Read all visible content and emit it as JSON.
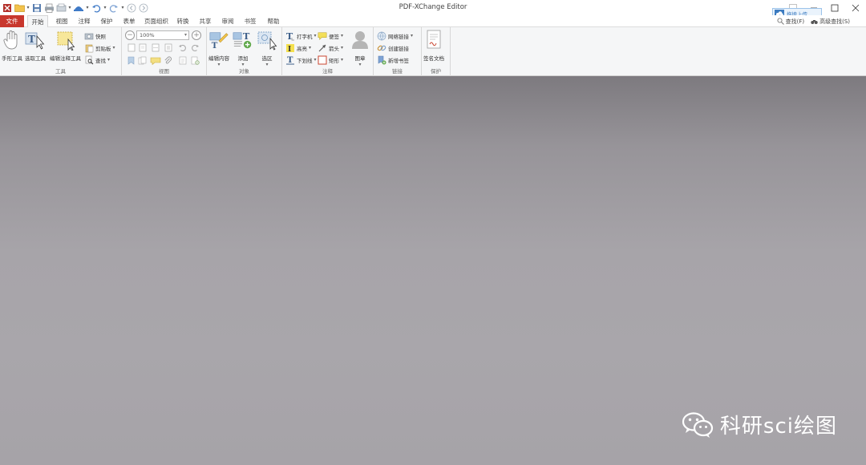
{
  "window": {
    "title": "PDF-XChange Editor",
    "minimize_icon": "minimize-icon",
    "maximize_icon": "maximize-icon",
    "close_icon": "close-icon"
  },
  "quick_access": {
    "icons": [
      "app-logo-icon",
      "open-folder-icon",
      "save-icon",
      "print-icon",
      "scan-icon",
      "stamp-icon",
      "undo-icon",
      "redo-icon",
      "back-icon",
      "forward-icon"
    ]
  },
  "tabs": [
    {
      "label": "文件",
      "active": false,
      "file": true
    },
    {
      "label": "开始",
      "active": true
    },
    {
      "label": "视图"
    },
    {
      "label": "注释"
    },
    {
      "label": "保护"
    },
    {
      "label": "表单"
    },
    {
      "label": "页面组织"
    },
    {
      "label": "转换"
    },
    {
      "label": "共享"
    },
    {
      "label": "审阅"
    },
    {
      "label": "书签"
    },
    {
      "label": "帮助"
    }
  ],
  "right_tools": {
    "cloud_upload": "拖拽上传",
    "find": "查找(F)",
    "advanced_search": "高级查找(S)"
  },
  "ribbon": {
    "tools": {
      "label": "工具",
      "hand_tool": "手形工具",
      "select_tool": "选取工具",
      "edit_annotation_tool": "编辑注释工具",
      "snapshot": "快照",
      "clipboard": "剪贴板",
      "find": "查找"
    },
    "view": {
      "label": "视图",
      "zoom_value": "100%"
    },
    "objects": {
      "label": "对象",
      "edit_content": "编辑内容",
      "add": "添加",
      "select_area": "选区"
    },
    "comment": {
      "label": "注释",
      "typewriter": "打字机",
      "sticky_note": "便签",
      "highlight": "高亮",
      "arrow": "箭头",
      "underline": "下划线",
      "rectangle": "矩形",
      "stamp": "图章"
    },
    "links": {
      "label": "链接",
      "web_links": "网络链接",
      "create_link": "创建链接",
      "add_bookmark": "新增书签"
    },
    "protect": {
      "label": "保护",
      "sign_document": "签名文档"
    }
  },
  "watermark": {
    "text": "科研sci绘图",
    "icon": "wechat-icon"
  },
  "colors": {
    "file_tab": "#c8372d",
    "ribbon_bg": "#f5f6f7",
    "doc_bg": "#a6a3a8"
  }
}
